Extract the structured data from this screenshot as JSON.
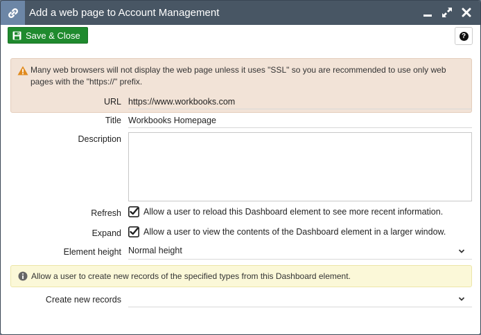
{
  "window": {
    "title": "Add a web page to Account Management"
  },
  "toolbar": {
    "save_label": "Save & Close",
    "help_glyph": "?"
  },
  "warning": {
    "text": "Many web browsers will not display the web page unless it uses \"SSL\" so you are recommended to use only web pages with the \"https://\" prefix."
  },
  "form": {
    "url_label": "URL",
    "url_value": "https://www.workbooks.com",
    "title_label": "Title",
    "title_value": "Workbooks Homepage",
    "description_label": "Description",
    "description_value": "",
    "refresh_label": "Refresh",
    "refresh_text": "Allow a user to reload this Dashboard element to see more recent information.",
    "refresh_checked": true,
    "expand_label": "Expand",
    "expand_text": "Allow a user to view the contents of the Dashboard element in a larger window.",
    "expand_checked": true,
    "height_label": "Element height",
    "height_value": "Normal height",
    "create_label": "Create new records",
    "create_value": ""
  },
  "info": {
    "text": "Allow a user to create new records of the specified types from this Dashboard element."
  },
  "icons": {
    "app": "link-icon",
    "minimize": "minimize-icon",
    "maximize": "maximize-icon",
    "close": "close-icon",
    "save": "floppy-disk-icon",
    "help": "help-icon",
    "warning": "warning-icon",
    "info": "info-icon",
    "checkbox": "checkbox-checked-icon",
    "chevron": "chevron-down-icon"
  },
  "colors": {
    "titlebar": "#485664",
    "save_button": "#1f8a2e",
    "warning_bg": "#f2e3d7",
    "info_bg": "#fbf8d8",
    "warning_icon": "#e08a1e"
  }
}
